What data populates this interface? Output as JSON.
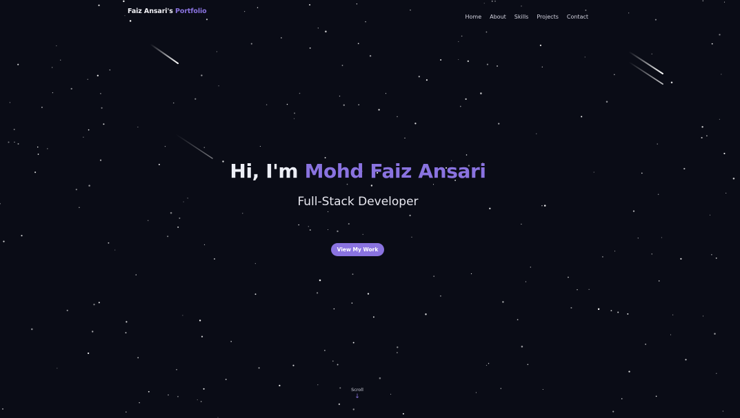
{
  "theme": {
    "background": "#0a0c16",
    "accent": "#8a73e0",
    "text": "#eceef5"
  },
  "nav": {
    "brand_prefix": "Faiz Ansari's",
    "brand_accent": "Portfolio",
    "links": [
      {
        "label": "Home"
      },
      {
        "label": "About"
      },
      {
        "label": "Skills"
      },
      {
        "label": "Projects"
      },
      {
        "label": "Contact"
      }
    ]
  },
  "hero": {
    "greeting": "Hi, I'm",
    "name": "Mohd Faiz Ansari",
    "subtitle": "Full-Stack Developer",
    "cta_label": "View My Work"
  },
  "scroll": {
    "label": "Scroll",
    "icon": "arrow-down-icon"
  }
}
